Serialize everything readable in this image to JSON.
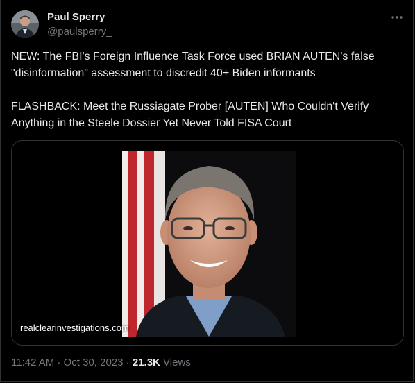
{
  "author": {
    "display_name": "Paul Sperry",
    "handle": "@paulsperry_"
  },
  "tweet": {
    "paragraph_1": "NEW: The FBI's Foreign Influence Task Force used BRIAN AUTEN's false \"disinformation\" assessment to discredit 40+ Biden informants",
    "paragraph_2": "FLASHBACK: Meet the Russiagate Prober [AUTEN] Who Couldn't Verify Anything in the Steele Dossier Yet Never Told FISA Court"
  },
  "card": {
    "domain": "realclearinvestigations.com"
  },
  "meta": {
    "time": "11:42 AM",
    "separator_1": " · ",
    "date": "Oct 30, 2023",
    "separator_2": " · ",
    "views_count": "21.3K",
    "views_label": " Views"
  },
  "icons": {
    "more": "more-horizontal-icon"
  },
  "colors": {
    "background": "#000000",
    "text_primary": "#e7e9ea",
    "text_secondary": "#71767b",
    "border": "#2f3336"
  }
}
